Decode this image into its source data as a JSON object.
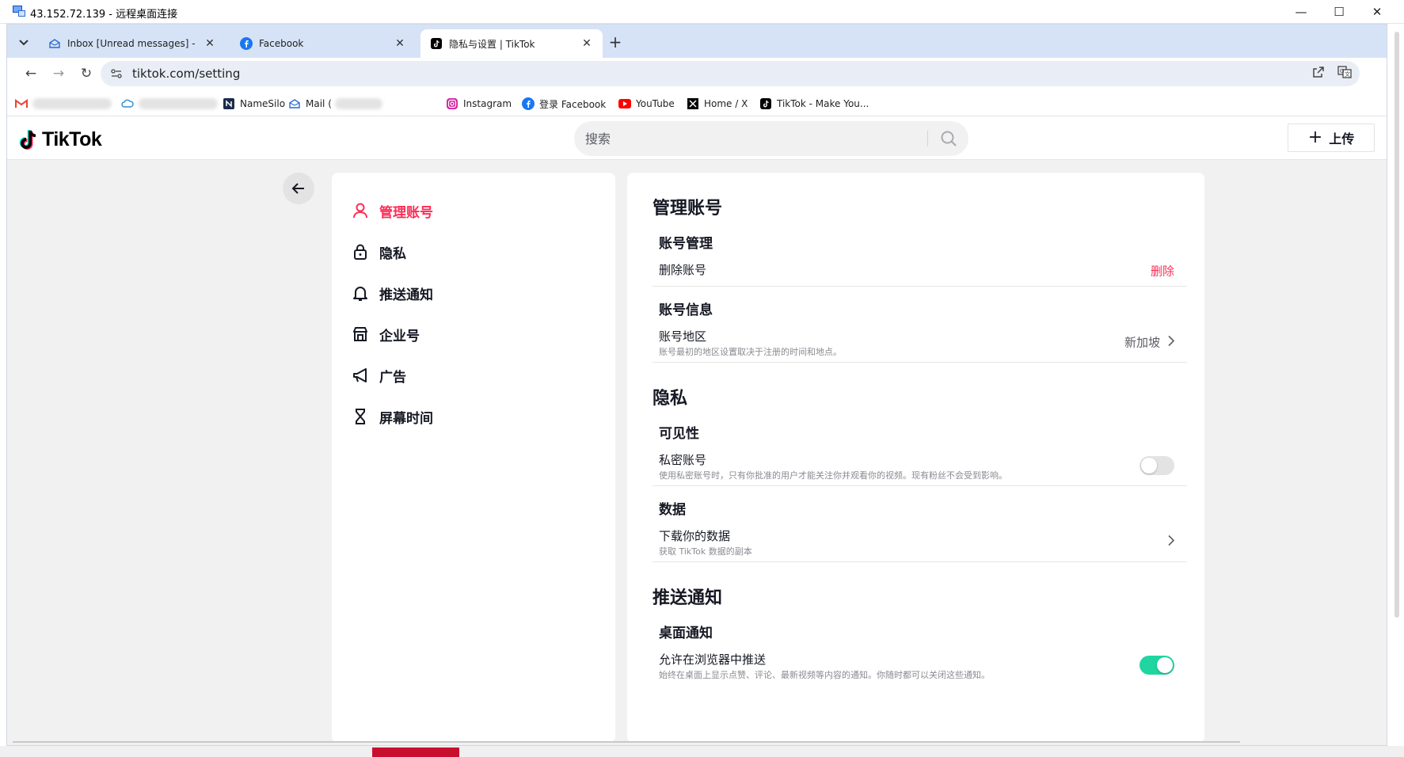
{
  "remote_window": {
    "title": "43.152.72.139 - 远程桌面连接",
    "minimize": "—",
    "maximize": "☐",
    "close": "✕"
  },
  "tabs": [
    {
      "label": "Inbox [Unread messages] - Z",
      "icon": "mail-icon",
      "active": false
    },
    {
      "label": "Facebook",
      "icon": "facebook-icon",
      "active": false
    },
    {
      "label": "隐私与设置 | TikTok",
      "icon": "tiktok-icon",
      "active": true
    }
  ],
  "toolbar": {
    "url": "tiktok.com/setting",
    "back": "←",
    "forward": "→",
    "reload": "↻"
  },
  "bookmarks": [
    {
      "label": "NameSilo",
      "icon": "namesilo-icon"
    },
    {
      "label": "Mail (",
      "icon": "mail-icon"
    },
    {
      "label": "Instagram",
      "icon": "instagram-icon"
    },
    {
      "label": "登录 Facebook",
      "icon": "facebook-icon"
    },
    {
      "label": "YouTube",
      "icon": "youtube-icon"
    },
    {
      "label": "Home / X",
      "icon": "x-icon"
    },
    {
      "label": "TikTok - Make You...",
      "icon": "tiktok-icon"
    }
  ],
  "tiktok": {
    "logo_text": "TikTok",
    "search_placeholder": "搜索",
    "upload_label": "上传"
  },
  "side_menu": [
    {
      "label": "管理账号",
      "icon": "user-icon",
      "active": true
    },
    {
      "label": "隐私",
      "icon": "lock-icon",
      "active": false
    },
    {
      "label": "推送通知",
      "icon": "bell-icon",
      "active": false
    },
    {
      "label": "企业号",
      "icon": "store-icon",
      "active": false
    },
    {
      "label": "广告",
      "icon": "megaphone-icon",
      "active": false
    },
    {
      "label": "屏幕时间",
      "icon": "hourglass-icon",
      "active": false
    }
  ],
  "settings": {
    "manage_account": {
      "title": "管理账号",
      "account_management": {
        "title": "账号管理",
        "delete_label": "删除账号",
        "delete_action": "删除"
      },
      "account_info": {
        "title": "账号信息",
        "region_label": "账号地区",
        "region_desc": "账号最初的地区设置取决于注册的时间和地点。",
        "region_value": "新加坡"
      }
    },
    "privacy": {
      "title": "隐私",
      "visibility": {
        "title": "可见性",
        "private_label": "私密账号",
        "private_desc": "使用私密账号时，只有你批准的用户才能关注你并观看你的视频。现有粉丝不会受到影响。",
        "private_on": false
      },
      "data": {
        "title": "数据",
        "download_label": "下载你的数据",
        "download_desc": "获取 TikTok 数据的副本"
      }
    },
    "push": {
      "title": "推送通知",
      "desktop": {
        "title": "桌面通知",
        "browser_label": "允许在浏览器中推送",
        "browser_desc": "始终在桌面上显示点赞、评论、最新视频等内容的通知。你随时都可以关闭这些通知。",
        "browser_on": true
      }
    }
  },
  "colors": {
    "accent": "#fe2c55",
    "toggle_on": "#20d5a0",
    "toggle_off": "#e3e3e4",
    "tab_strip": "#d6e3f7"
  }
}
